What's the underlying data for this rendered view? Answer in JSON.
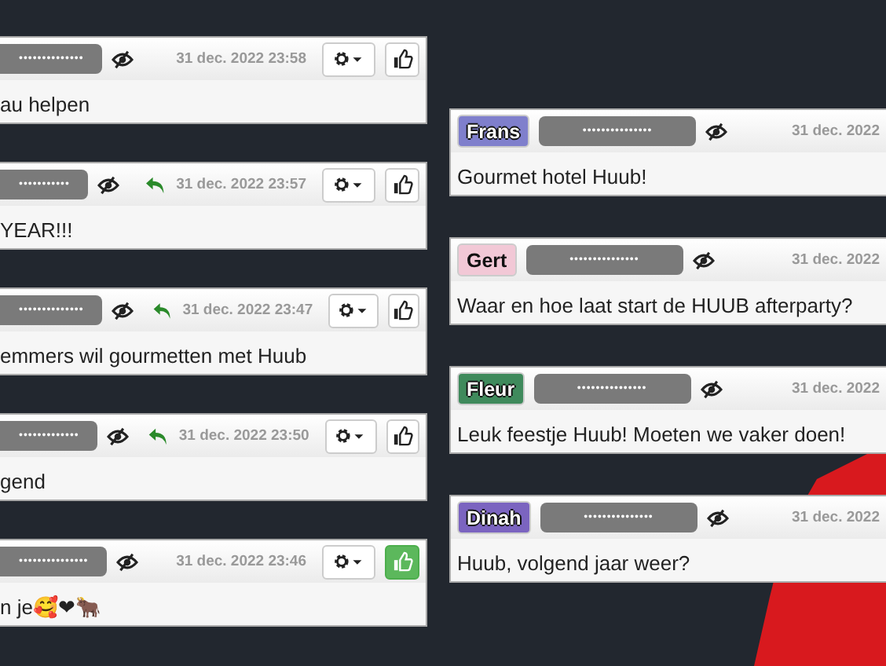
{
  "left_messages": [
    {
      "masked_name": "••••••••••••••",
      "replied": false,
      "date": "31 dec. 2022 23:58",
      "liked": false,
      "text": "au helpen"
    },
    {
      "masked_name": "•••••••••••",
      "replied": true,
      "date": "31 dec. 2022 23:57",
      "liked": false,
      "text": "YEAR!!!"
    },
    {
      "masked_name": "••••••••••••••",
      "replied": true,
      "date": "31 dec. 2022 23:47",
      "liked": false,
      "text": "emmers wil gourmetten met Huub"
    },
    {
      "masked_name": "•••••••••••••",
      "replied": true,
      "date": "31 dec. 2022 23:50",
      "liked": false,
      "text": "gend"
    },
    {
      "masked_name": "•••••••••••••••",
      "replied": false,
      "date": "31 dec. 2022 23:46",
      "liked": true,
      "text": "n je🥰❤🐂"
    }
  ],
  "right_messages": [
    {
      "author": "Frans",
      "color": "#7f7fcc",
      "masked_name": "•••••••••••••••",
      "date": "31 dec. 2022",
      "text": "Gourmet hotel Huub!"
    },
    {
      "author": "Gert",
      "color": "#f2c8d6",
      "masked_name": "•••••••••••••••",
      "date": "31 dec. 2022",
      "text": "Waar en hoe laat start de HUUB afterparty?"
    },
    {
      "author": "Fleur",
      "color": "#3f8a5c",
      "masked_name": "•••••••••••••••",
      "date": "31 dec. 2022",
      "text": "Leuk feestje Huub! Moeten we vaker doen!"
    },
    {
      "author": "Dinah",
      "color": "#7b64c0",
      "masked_name": "•••••••••••••••",
      "date": "31 dec. 2022",
      "text": "Huub, volgend jaar weer?"
    }
  ]
}
